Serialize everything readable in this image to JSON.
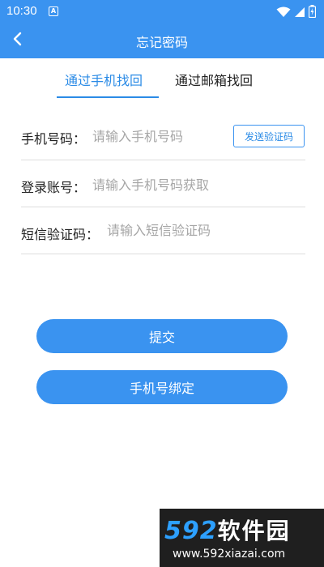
{
  "status_bar": {
    "time": "10:30",
    "notification_badge": "A",
    "icons": [
      "wifi-icon",
      "signal-icon",
      "battery-icon"
    ]
  },
  "app_bar": {
    "title": "忘记密码",
    "back_icon": "chevron-left-icon"
  },
  "tabs": [
    {
      "label": "通过手机找回",
      "active": true
    },
    {
      "label": "通过邮箱找回",
      "active": false
    }
  ],
  "form": {
    "phone": {
      "label": "手机号码：",
      "placeholder": "请输入手机号码",
      "value": ""
    },
    "send_code_label": "发送验证码",
    "account": {
      "label": "登录账号：",
      "placeholder": "请输入手机号码获取",
      "value": ""
    },
    "sms_code": {
      "label": "短信验证码：",
      "placeholder": "请输入短信验证码",
      "value": ""
    }
  },
  "buttons": {
    "submit": "提交",
    "bind_phone": "手机号绑定"
  },
  "watermark": {
    "brand_number": "592",
    "brand_text": "软件园",
    "url": "www.592xiazai.com"
  },
  "colors": {
    "primary": "#3a93f0",
    "accent_text": "#2b8be6",
    "placeholder": "#a6a6a6",
    "divider": "#dedede"
  }
}
